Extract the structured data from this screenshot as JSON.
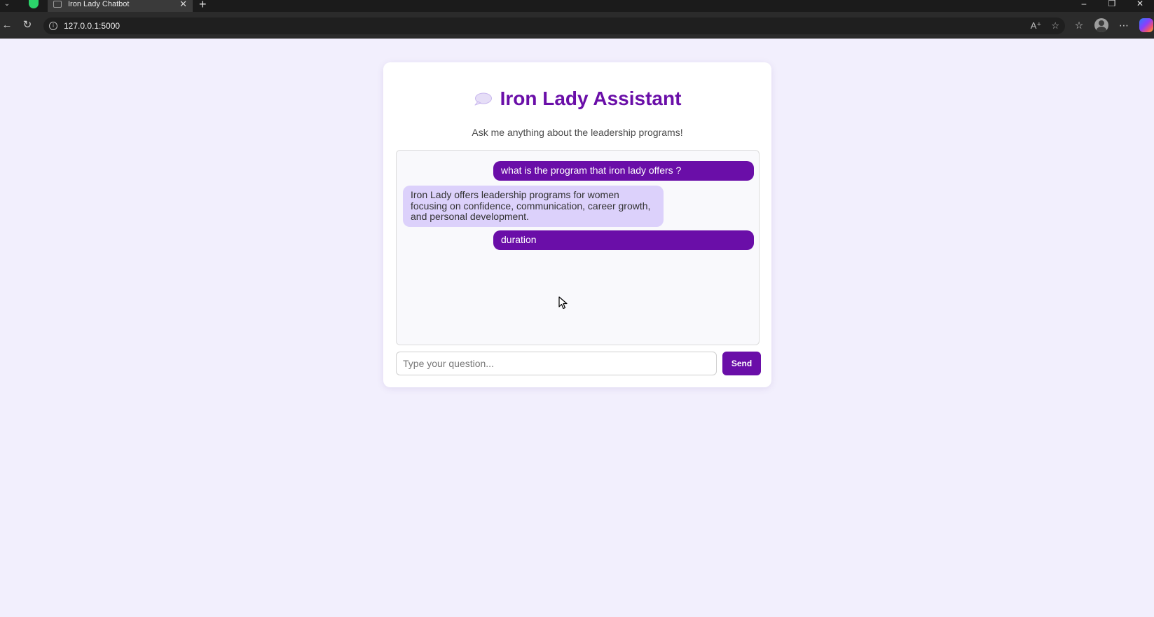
{
  "browser": {
    "pinned_tab_icon": "green-app-icon",
    "active_tab": {
      "title": "Iron Lady Chatbot",
      "favicon": "page-icon"
    },
    "url": "127.0.0.1:5000"
  },
  "page": {
    "title": "Iron Lady Assistant",
    "title_icon": "speech-bubble-icon",
    "subtitle": "Ask me anything about the leadership programs!",
    "messages": [
      {
        "role": "user",
        "text": "what is the program that iron lady offers ?"
      },
      {
        "role": "bot",
        "text": "Iron Lady offers leadership programs for women focusing on confidence, communication, career growth, and personal development."
      },
      {
        "role": "user",
        "text": "duration"
      }
    ],
    "input": {
      "value": "",
      "placeholder": "Type your question..."
    },
    "send_label": "Send"
  },
  "colors": {
    "accent": "#6a0ea8",
    "bot_bubble": "#dcd1fb",
    "page_background": "#f2effd"
  }
}
